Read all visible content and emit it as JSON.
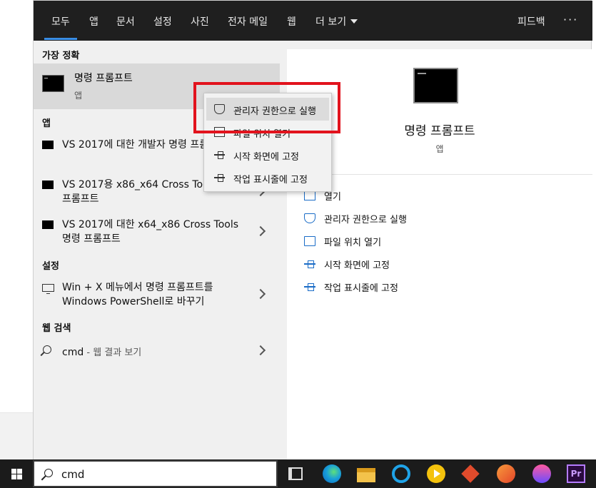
{
  "tabs": [
    {
      "label": "모두"
    },
    {
      "label": "앱"
    },
    {
      "label": "문서"
    },
    {
      "label": "설정"
    },
    {
      "label": "사진"
    },
    {
      "label": "전자 메일"
    },
    {
      "label": "웹"
    },
    {
      "label": "더 보기"
    }
  ],
  "feedback_label": "피드백",
  "more_label": "···",
  "sections": {
    "best_match": "가장 정확",
    "apps": "앱",
    "settings": "설정",
    "web": "웹 검색"
  },
  "best_match": {
    "name": "명령 프롬프트",
    "type": "앱"
  },
  "apps": [
    {
      "label": "VS 2017에 대한 개발자 명령 프롬프트"
    },
    {
      "label": "VS 2017용 x86_x64 Cross Tools 명령 프롬프트"
    },
    {
      "label": "VS 2017에 대한 x64_x86 Cross Tools 명령 프롬프트"
    }
  ],
  "settings_item": {
    "label": "Win + X 메뉴에서 명령 프롬프트를 Windows PowerShell로 바꾸기"
  },
  "web_item": {
    "query": "cmd",
    "suffix": " - 웹 결과 보기"
  },
  "detail": {
    "title": "명령 프롬프트",
    "subtitle": "앱",
    "actions": [
      {
        "label": "열기",
        "icon": "open-icon"
      },
      {
        "label": "관리자 권한으로 실행",
        "icon": "shield-icon"
      },
      {
        "label": "파일 위치 열기",
        "icon": "folder-icon"
      },
      {
        "label": "시작 화면에 고정",
        "icon": "pin-icon"
      },
      {
        "label": "작업 표시줄에 고정",
        "icon": "pin-icon"
      }
    ]
  },
  "context_menu": [
    {
      "label": "관리자 권한으로 실행",
      "icon": "shield-icon"
    },
    {
      "label": "파일 위치 열기",
      "icon": "folder-icon"
    },
    {
      "label": "시작 화면에 고정",
      "icon": "pin-icon"
    },
    {
      "label": "작업 표시줄에 고정",
      "icon": "pin-icon"
    }
  ],
  "taskbar": {
    "search_value": "cmd",
    "pinned": [
      "task-view-icon",
      "edge-icon",
      "file-explorer-icon",
      "internet-explorer-icon",
      "media-player-icon",
      "git-icon",
      "swift-icon",
      "drop-app-icon",
      "premiere-icon"
    ],
    "premiere_label": "Pr"
  },
  "colors": {
    "highlight_box": "#e2131d",
    "tab_underline": "#3a8ee6",
    "action_icon": "#1a6cc7"
  }
}
